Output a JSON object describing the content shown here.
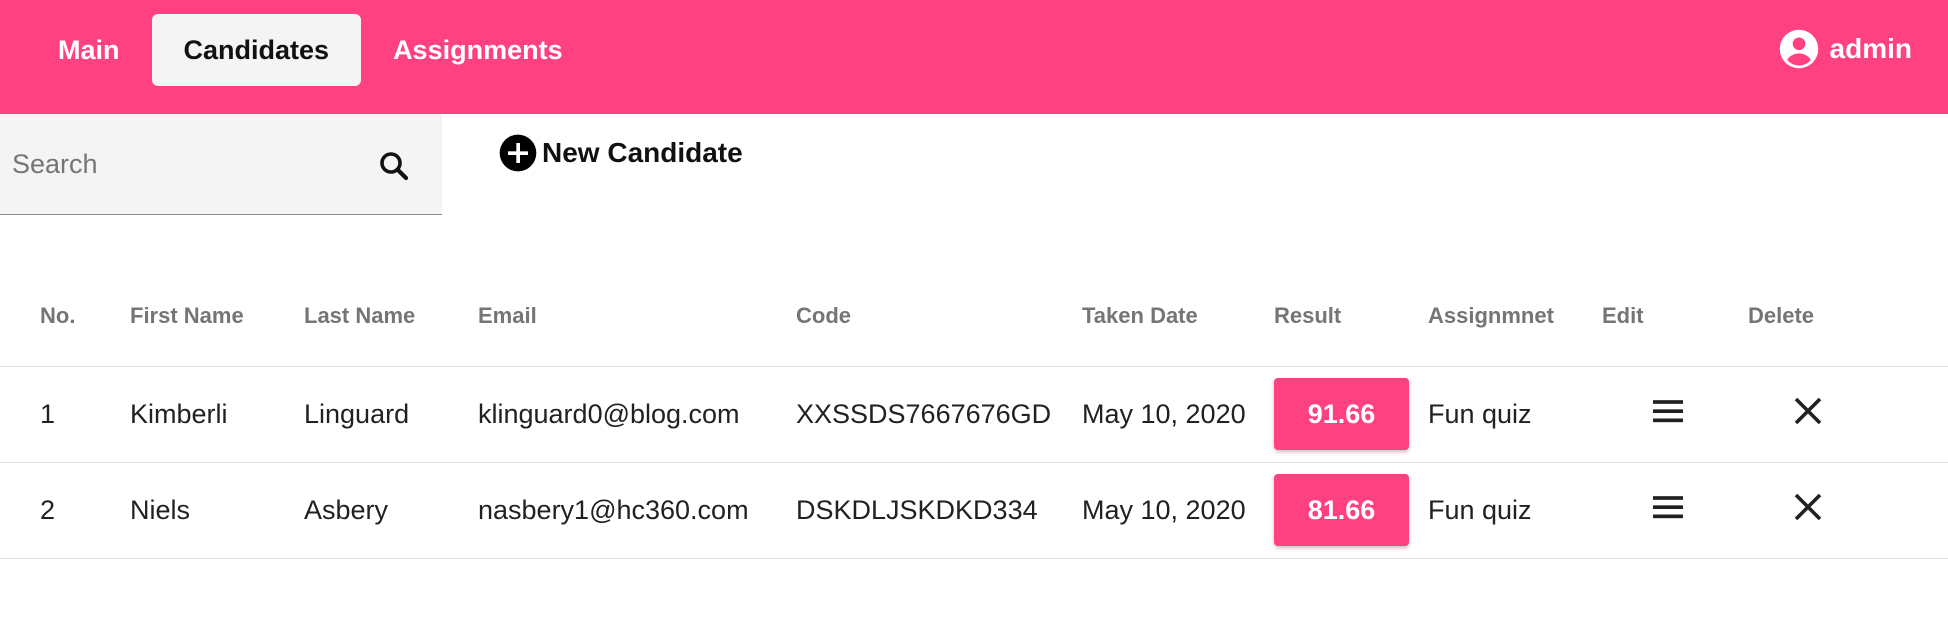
{
  "nav": {
    "tabs": [
      {
        "label": "Main"
      },
      {
        "label": "Candidates"
      },
      {
        "label": "Assignments"
      }
    ],
    "active_tab": "Candidates"
  },
  "user": {
    "name": "admin",
    "icon": "account-circle-icon"
  },
  "search": {
    "placeholder": "Search",
    "value": ""
  },
  "actions": {
    "new_candidate_label": "New Candidate"
  },
  "table": {
    "headers": [
      "No.",
      "First Name",
      "Last Name",
      "Email",
      "Code",
      "Taken Date",
      "Result",
      "Assignmnet",
      "Edit",
      "Delete"
    ],
    "rows": [
      {
        "no": "1",
        "first_name": "Kimberli",
        "last_name": "Linguard",
        "email": "klinguard0@blog.com",
        "code": "XXSSDS7667676GD",
        "taken_date": "May 10, 2020",
        "result": "91.66",
        "assignment": "Fun quiz"
      },
      {
        "no": "2",
        "first_name": "Niels",
        "last_name": "Asbery",
        "email": "nasbery1@hc360.com",
        "code": "DSKDLJSKDKD334",
        "taken_date": "May 10, 2020",
        "result": "81.66",
        "assignment": "Fun quiz"
      }
    ]
  },
  "colors": {
    "accent": "#ff4081",
    "header_text": "#757575"
  }
}
